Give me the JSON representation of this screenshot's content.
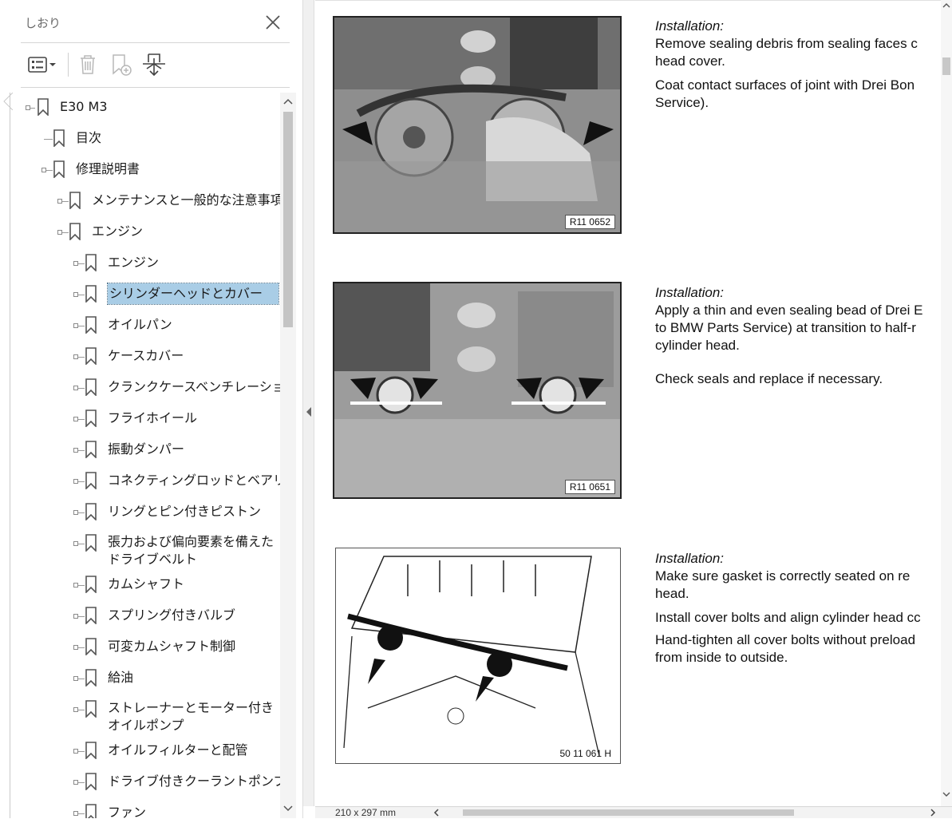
{
  "panel": {
    "title": "しおり",
    "bookmarks": [
      {
        "label": "E30 M3",
        "level": 0
      },
      {
        "label": "目次",
        "level": 1
      },
      {
        "label": "修理説明書",
        "level": 1
      },
      {
        "label": "メンテナンスと一般的な注意事項",
        "level": 2
      },
      {
        "label": "エンジン",
        "level": 2
      },
      {
        "label": "エンジン",
        "level": 3
      },
      {
        "label": "シリンダーヘッドとカバー",
        "level": 3,
        "selected": true
      },
      {
        "label": "オイルパン",
        "level": 3
      },
      {
        "label": "ケースカバー",
        "level": 3
      },
      {
        "label": "クランクケースベンチレーション",
        "level": 3
      },
      {
        "label": "フライホイール",
        "level": 3
      },
      {
        "label": "振動ダンパー",
        "level": 3
      },
      {
        "label": "コネクティングロッドとベアリング",
        "level": 3
      },
      {
        "label": "リングとピン付きピストン",
        "level": 3
      },
      {
        "label": "張力および偏向要素を備えたドライブベルト",
        "level": 3
      },
      {
        "label": "カムシャフト",
        "level": 3
      },
      {
        "label": "スプリング付きバルブ",
        "level": 3
      },
      {
        "label": "可変カムシャフト制御",
        "level": 3
      },
      {
        "label": "給油",
        "level": 3
      },
      {
        "label": "ストレーナーとモーター付きオイルポンプ",
        "level": 3
      },
      {
        "label": "オイルフィルターと配管",
        "level": 3
      },
      {
        "label": "ドライブ付きクーラントポンプ",
        "level": 3
      },
      {
        "label": "ファン",
        "level": 3
      }
    ]
  },
  "document": {
    "sections": [
      {
        "figure_label": "R11 0652",
        "heading": "Installation:",
        "paragraphs": [
          "Remove sealing debris from sealing faces c\nhead cover.",
          "Coat contact surfaces of joint with Drei Bon\nService)."
        ]
      },
      {
        "figure_label": "R11 0651",
        "heading": "Installation:",
        "paragraphs": [
          "Apply a thin and even sealing bead of Drei E\nto BMW Parts Service) at transition to half-r\ncylinder head.",
          "Check seals and replace if necessary."
        ]
      },
      {
        "figure_label": "50 11 061 H",
        "heading": "Installation:",
        "paragraphs": [
          "Make sure gasket is correctly seated on re\nhead.",
          "Install cover bolts and align cylinder head cc",
          "Hand-tighten all cover bolts without preload\nfrom inside to outside."
        ]
      }
    ]
  },
  "status": {
    "page_size": "210 x 297 mm"
  }
}
